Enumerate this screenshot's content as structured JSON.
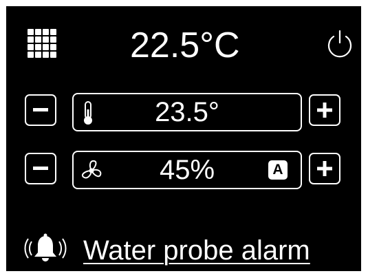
{
  "header": {
    "menu_icon": "grid-menu-icon",
    "current_temperature": "22.5°C",
    "power_icon": "power-icon"
  },
  "setpoint": {
    "decrease_icon": "minus-icon",
    "increase_icon": "plus-icon",
    "icon": "thermometer-icon",
    "value": "23.5°"
  },
  "fan": {
    "decrease_icon": "minus-icon",
    "increase_icon": "plus-icon",
    "icon": "fan-icon",
    "value": "45%",
    "mode_badge": "A"
  },
  "alarm": {
    "icon": "bell-alarm-icon",
    "text": "Water probe alarm"
  },
  "colors": {
    "background": "#000000",
    "foreground": "#ffffff"
  }
}
